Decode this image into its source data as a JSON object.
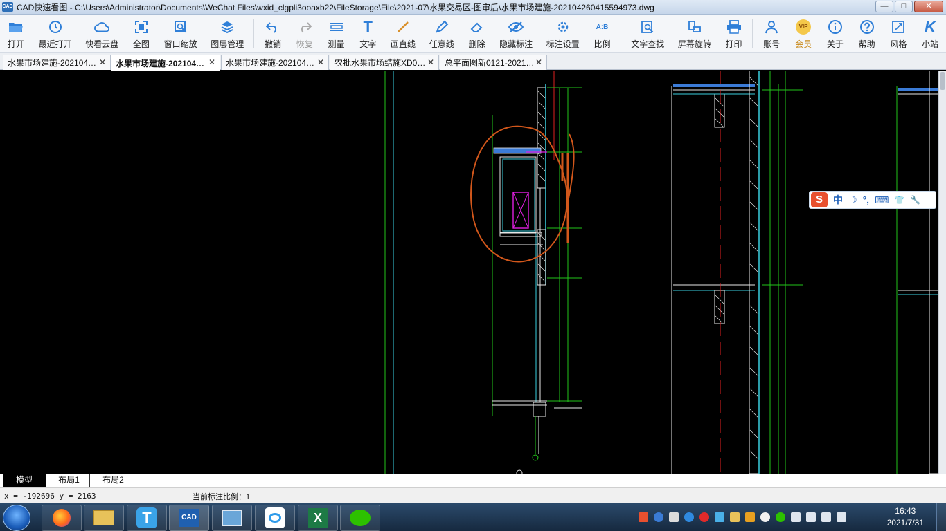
{
  "window": {
    "logo_text": "CAD",
    "title": "CAD快速看图 - C:\\Users\\Administrator\\Documents\\WeChat Files\\wxid_clgpli3ooaxb22\\FileStorage\\File\\2021-07\\水果交易区-图审后\\水果市场建施-202104260415594973.dwg",
    "min_glyph": "—",
    "max_glyph": "□",
    "close_glyph": "✕"
  },
  "toolbar": {
    "items": [
      {
        "label": "打开",
        "icon": "folder-open-icon"
      },
      {
        "label": "最近打开",
        "icon": "history-icon"
      },
      {
        "label": "快看云盘",
        "icon": "cloud-icon"
      },
      {
        "label": "全图",
        "icon": "fit-view-icon"
      },
      {
        "label": "窗口缩放",
        "icon": "zoom-window-icon"
      },
      {
        "label": "图层管理",
        "icon": "layers-icon"
      },
      {
        "label": "撤销",
        "icon": "undo-icon"
      },
      {
        "label": "恢复",
        "icon": "redo-icon"
      },
      {
        "label": "测量",
        "icon": "measure-icon"
      },
      {
        "label": "文字",
        "icon": "text-icon"
      },
      {
        "label": "画直线",
        "icon": "line-icon"
      },
      {
        "label": "任意线",
        "icon": "pencil-icon"
      },
      {
        "label": "删除",
        "icon": "eraser-icon"
      },
      {
        "label": "隐藏标注",
        "icon": "eye-hide-icon"
      },
      {
        "label": "标注设置",
        "icon": "settings-icon"
      },
      {
        "label": "比例",
        "icon": "scale-icon"
      },
      {
        "label": "文字查找",
        "icon": "text-search-icon"
      },
      {
        "label": "屏幕旋转",
        "icon": "rotate-screen-icon"
      },
      {
        "label": "打印",
        "icon": "printer-icon"
      },
      {
        "label": "账号",
        "icon": "user-icon"
      },
      {
        "label": "会员",
        "icon": "vip-icon"
      },
      {
        "label": "关于",
        "icon": "info-icon"
      },
      {
        "label": "帮助",
        "icon": "help-icon"
      },
      {
        "label": "风格",
        "icon": "style-icon"
      },
      {
        "label": "小站",
        "icon": "k-logo-icon"
      }
    ],
    "ab_glyph": "A:B",
    "vip_glyph": "VIP",
    "k_glyph": "K",
    "text_glyph": "T"
  },
  "tabs": [
    {
      "label": "水果市场建施-202104…",
      "close": "✕",
      "active": false
    },
    {
      "label": "水果市场建施-202104…",
      "close": "✕",
      "active": true
    },
    {
      "label": "水果市场建施-202104…",
      "close": "✕",
      "active": false
    },
    {
      "label": "农批水果市场结施XD0…",
      "close": "✕",
      "active": false
    },
    {
      "label": "总平面图新0121-2021…",
      "close": "✕",
      "active": false
    }
  ],
  "layout_tabs": [
    {
      "label": "模型",
      "active": true
    },
    {
      "label": "布局1",
      "active": false
    },
    {
      "label": "布局2",
      "active": false
    }
  ],
  "status": {
    "coords": "x = -192696 y = 2163",
    "scale": "当前标注比例：1"
  },
  "ime": {
    "logo": "S",
    "lang": "中",
    "moon": "☽",
    "punct": "°,",
    "keyboard": "⌨",
    "shirt": "👕",
    "wrench": "🔧"
  },
  "taskbar": {
    "time": "16:43",
    "date": "2021/7/31",
    "apps": [
      "firefox",
      "file-explorer",
      "t-app",
      "cad-viewer",
      "remote-desktop",
      "baidu-netdisk",
      "excel",
      "wechat"
    ]
  },
  "colors": {
    "cad_green": "#22c41a",
    "cad_cyan": "#3ad0e0",
    "cad_white": "#e8e8e8",
    "cad_magenta": "#e020e0",
    "cad_red": "#e02020",
    "annotation_orange": "#d2571b"
  }
}
